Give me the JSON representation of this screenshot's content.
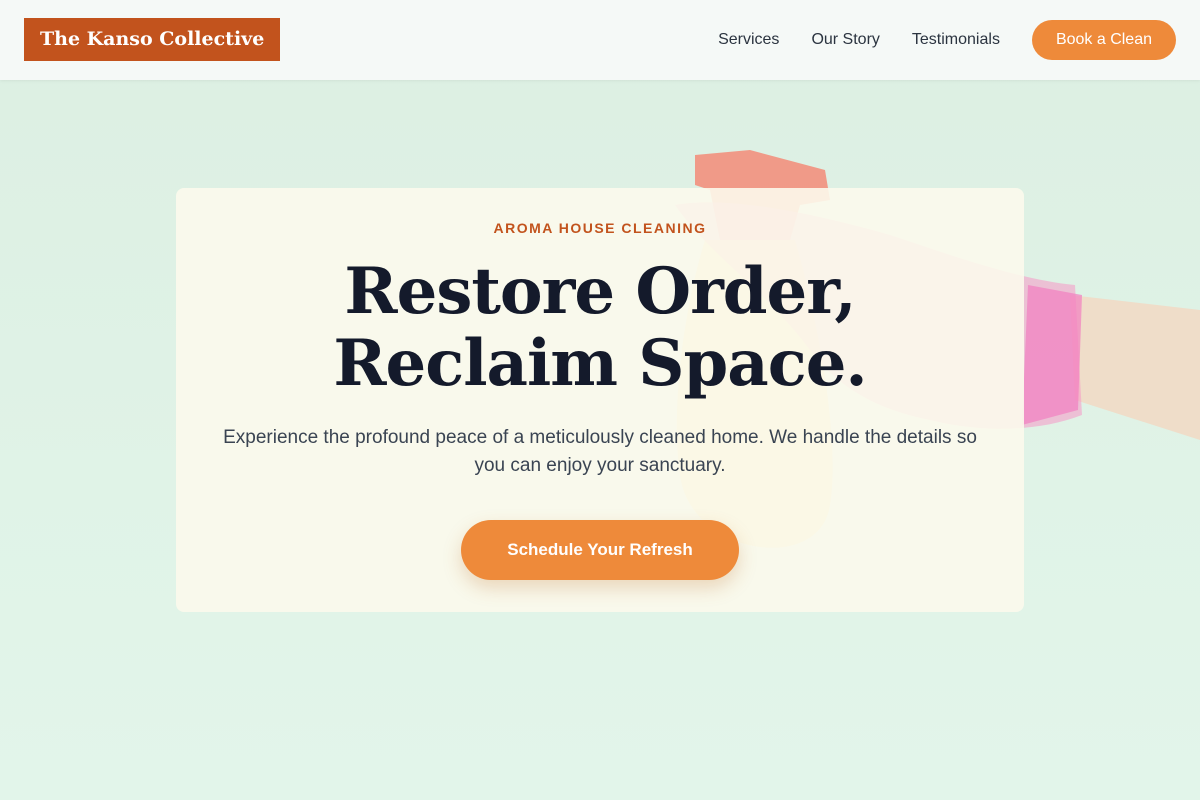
{
  "brand": {
    "name": "The Kanso Collective"
  },
  "nav": {
    "links": [
      "Services",
      "Our Story",
      "Testimonials"
    ],
    "cta_label": "Book a Clean"
  },
  "hero": {
    "eyebrow": "AROMA HOUSE CLEANING",
    "headline": "Restore Order, Reclaim Space.",
    "subtext": "Experience the profound peace of a meticulously cleaned home. We handle the details so you can enjoy your sanctuary.",
    "cta_label": "Schedule Your Refresh",
    "illustration": "spray-bottle-glove-icon"
  },
  "colors": {
    "brand": "#c2531d",
    "accent": "#ee8a3a",
    "heading": "#141a2b",
    "background": "#dcefe2"
  }
}
